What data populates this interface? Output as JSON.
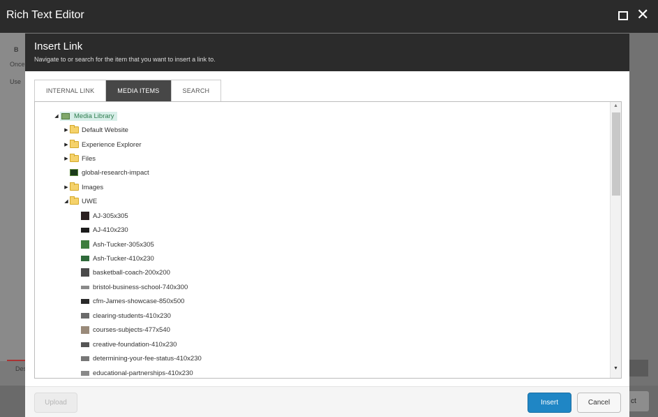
{
  "window": {
    "title": "Rich Text Editor",
    "maximize_icon": "maximize-icon",
    "close_icon": "close-icon"
  },
  "background": {
    "toolbar_bold": "B",
    "line1": "Once",
    "line2": "Use",
    "description_fragment": "Des",
    "select_fragment": "ct"
  },
  "dialog": {
    "title": "Insert Link",
    "subtitle": "Navigate to or search for the item that you want to insert a link to.",
    "tabs": [
      {
        "label": "INTERNAL LINK",
        "active": false
      },
      {
        "label": "MEDIA ITEMS",
        "active": true
      },
      {
        "label": "SEARCH",
        "active": false
      }
    ],
    "tree": {
      "root": {
        "label": "Media Library",
        "expanded": true,
        "selected": true,
        "icon": "media-library-icon"
      },
      "items": [
        {
          "label": "Default Website",
          "type": "folder",
          "expandable": true
        },
        {
          "label": "Experience Explorer",
          "type": "folder",
          "expandable": true
        },
        {
          "label": "Files",
          "type": "folder",
          "expandable": true
        },
        {
          "label": "global-research-impact",
          "type": "image",
          "expandable": false
        },
        {
          "label": "Images",
          "type": "folder",
          "expandable": true
        },
        {
          "label": "UWE",
          "type": "folder",
          "expandable": true,
          "expanded": true
        }
      ],
      "uwe_children": [
        "AJ-305x305",
        "AJ-410x230",
        "Ash-Tucker-305x305",
        "Ash-Tucker-410x230",
        "basketball-coach-200x200",
        "bristol-business-school-740x300",
        "cfm-James-showcase-850x500",
        "clearing-students-410x230",
        "courses-subjects-477x540",
        "creative-foundation-410x230",
        "determining-your-fee-status-410x230",
        "educational-partnerships-410x230"
      ]
    },
    "buttons": {
      "upload": "Upload",
      "insert": "Insert",
      "cancel": "Cancel"
    }
  },
  "colors": {
    "header_bg": "#2b2b2b",
    "active_tab": "#474747",
    "insert_button": "#1f86c5",
    "selected_node_bg": "#d7eee8"
  }
}
